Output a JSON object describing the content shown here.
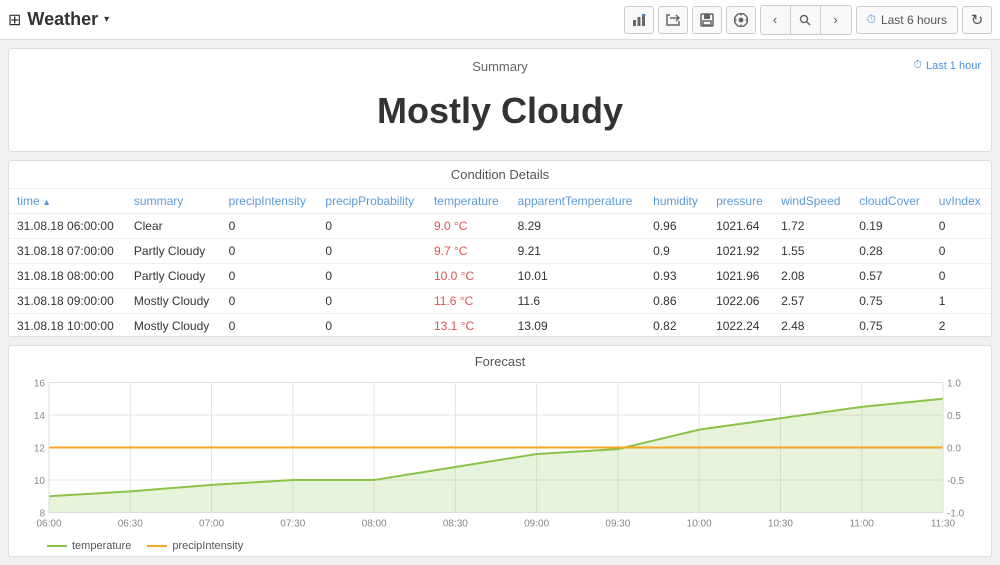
{
  "header": {
    "title": "Weather",
    "dropdown_arrow": "▾",
    "time_range": "Last 6 hours",
    "icons": {
      "grid": "⊞",
      "chart_plus": "📊",
      "share": "↗",
      "save": "💾",
      "settings": "⚙",
      "nav_left": "‹",
      "zoom": "🔍",
      "nav_right": "›",
      "clock": "⏱",
      "refresh": "↻"
    }
  },
  "summary": {
    "title": "Summary",
    "badge": "Last 1 hour",
    "condition": "Mostly Cloudy"
  },
  "condition_details": {
    "title": "Condition Details",
    "columns": [
      "time",
      "summary",
      "precipIntensity",
      "precipProbability",
      "temperature",
      "apparentTemperature",
      "humidity",
      "pressure",
      "windSpeed",
      "cloudCover",
      "uvIndex"
    ],
    "sort_col": "time",
    "sort_dir": "asc",
    "rows": [
      {
        "time": "31.08.18 06:00:00",
        "summary": "Clear",
        "precipIntensity": "0",
        "precipProbability": "0",
        "temperature": "9.0 °C",
        "apparentTemperature": "8.29",
        "humidity": "0.96",
        "pressure": "1021.64",
        "windSpeed": "1.72",
        "cloudCover": "0.19",
        "uvIndex": "0"
      },
      {
        "time": "31.08.18 07:00:00",
        "summary": "Partly Cloudy",
        "precipIntensity": "0",
        "precipProbability": "0",
        "temperature": "9.7 °C",
        "apparentTemperature": "9.21",
        "humidity": "0.9",
        "pressure": "1021.92",
        "windSpeed": "1.55",
        "cloudCover": "0.28",
        "uvIndex": "0"
      },
      {
        "time": "31.08.18 08:00:00",
        "summary": "Partly Cloudy",
        "precipIntensity": "0",
        "precipProbability": "0",
        "temperature": "10.0 °C",
        "apparentTemperature": "10.01",
        "humidity": "0.93",
        "pressure": "1021.96",
        "windSpeed": "2.08",
        "cloudCover": "0.57",
        "uvIndex": "0"
      },
      {
        "time": "31.08.18 09:00:00",
        "summary": "Mostly Cloudy",
        "precipIntensity": "0",
        "precipProbability": "0",
        "temperature": "11.6 °C",
        "apparentTemperature": "11.6",
        "humidity": "0.86",
        "pressure": "1022.06",
        "windSpeed": "2.57",
        "cloudCover": "0.75",
        "uvIndex": "1"
      },
      {
        "time": "31.08.18 10:00:00",
        "summary": "Mostly Cloudy",
        "precipIntensity": "0",
        "precipProbability": "0",
        "temperature": "13.1 °C",
        "apparentTemperature": "13.09",
        "humidity": "0.82",
        "pressure": "1022.24",
        "windSpeed": "2.48",
        "cloudCover": "0.75",
        "uvIndex": "2"
      }
    ]
  },
  "forecast": {
    "title": "Forecast",
    "x_labels": [
      "06:00",
      "06:30",
      "07:00",
      "07:30",
      "08:00",
      "08:30",
      "09:00",
      "09:30",
      "10:00",
      "10:30",
      "11:00",
      "11:30"
    ],
    "y_left": {
      "min": 8,
      "max": 16,
      "labels": [
        "8",
        "10",
        "12",
        "14",
        "16"
      ]
    },
    "y_right": {
      "min": -1,
      "max": 1,
      "labels": [
        "-1.0",
        "-0.5",
        "0",
        "0.5",
        "1.0"
      ]
    },
    "temperature_data": [
      9,
      9.3,
      9.7,
      10.0,
      10.0,
      10.8,
      11.6,
      11.9,
      13.1,
      13.8,
      14.5,
      15.0
    ],
    "precipitation_data": [
      12,
      12,
      12,
      12,
      12,
      12,
      12,
      12,
      12,
      12,
      12,
      12
    ],
    "legend": {
      "temperature": "temperature",
      "precipitation": "precipIntensity"
    }
  }
}
